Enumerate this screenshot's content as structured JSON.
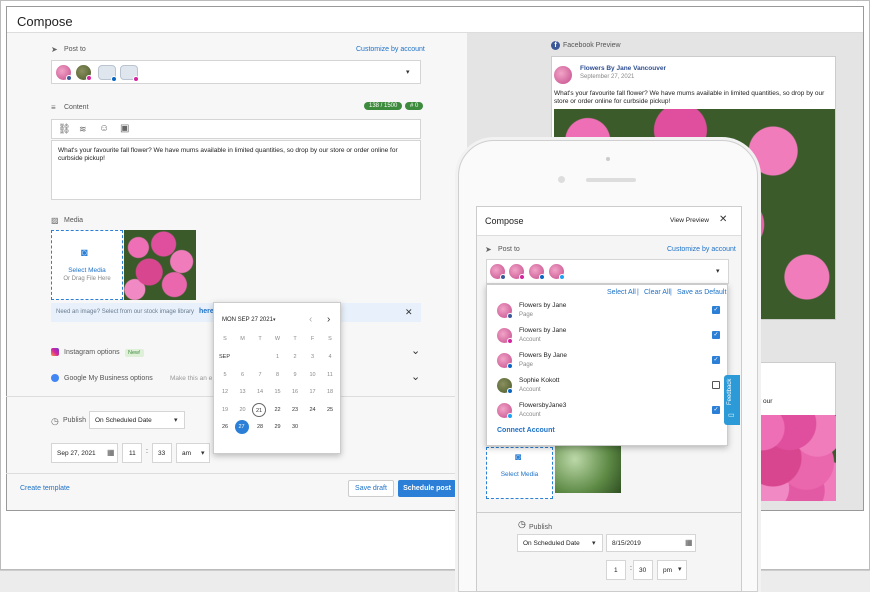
{
  "compose": {
    "title": "Compose",
    "post_to_label": "Post to",
    "customize_link": "Customize by account",
    "content_label": "Content",
    "char_count": "138 / 1500",
    "hashtag_count": "# 0",
    "content_text": "What's your favourite fall flower? We have mums available in limited quantities, so drop by our store or order online for curbside pickup!",
    "media_label": "Media",
    "upload_primary": "Select Media",
    "upload_secondary": "Or Drag File Here",
    "stock_hint": "Need an image? Select from our stock image library",
    "stock_link": "here",
    "instagram_options": "Instagram options",
    "new_badge": "New!",
    "gmb_options": "Google My Business options",
    "gmb_hint": "Make this an e",
    "publish_label": "Publish",
    "publish_mode": "On Scheduled Date",
    "date_value": "Sep 27, 2021",
    "hour": "11",
    "minute": "33",
    "ampm": "am",
    "create_template": "Create template",
    "save_draft": "Save draft",
    "schedule_post": "Schedule post"
  },
  "preview": {
    "label": "Facebook Preview",
    "page_name": "Flowers By Jane Vancouver",
    "date": "September 27, 2021",
    "text": "What's your favourite fall flower? We have mums available in limited quantities, so drop by our store or order online for curbside pickup!",
    "text_snippet2": "y our"
  },
  "calendar": {
    "month_label": "MON SEP 27 2021",
    "weekdays": [
      "S",
      "M",
      "T",
      "W",
      "T",
      "F",
      "S"
    ],
    "month_short": "SEP",
    "today": "21",
    "selected": "27"
  },
  "mobile": {
    "title": "Compose",
    "view_preview": "View Preview",
    "post_to": "Post to",
    "customize_link": "Customize by account",
    "select_all": "Select All",
    "clear_all": "Clear All",
    "save_default": "Save as Default",
    "accounts": [
      {
        "name": "Flowers by Jane",
        "type": "Page",
        "checked": true
      },
      {
        "name": "Flowers by Jane",
        "type": "Account",
        "checked": true
      },
      {
        "name": "Flowers By Jane",
        "type": "Page",
        "checked": true
      },
      {
        "name": "Sophie Kokott",
        "type": "Account",
        "checked": false
      },
      {
        "name": "FlowersbyJane3",
        "type": "Account",
        "checked": true
      }
    ],
    "connect_account": "Connect Account",
    "select_media": "Select Media",
    "publish_label": "Publish",
    "publish_mode": "On Scheduled Date",
    "date_value": "8/15/2019",
    "hour": "1",
    "minute": "30",
    "ampm": "pm",
    "feedback": "Feedback"
  }
}
